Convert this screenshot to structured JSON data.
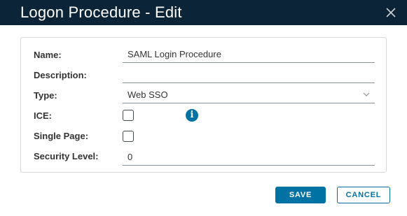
{
  "dialog": {
    "title": "Logon Procedure - Edit",
    "close_icon": "close-icon"
  },
  "form": {
    "name": {
      "label": "Name:",
      "value": "SAML Login Procedure"
    },
    "description": {
      "label": "Description:",
      "value": ""
    },
    "type": {
      "label": "Type:",
      "value": "Web SSO",
      "icon": "chevron-down-icon"
    },
    "ice": {
      "label": "ICE:",
      "checked": false,
      "info_icon": "info-icon",
      "info_glyph": "i"
    },
    "single_page": {
      "label": "Single Page:",
      "checked": false
    },
    "security_level": {
      "label": "Security Level:",
      "value": "0"
    }
  },
  "footer": {
    "save_label": "SAVE",
    "cancel_label": "CANCEL"
  },
  "colors": {
    "header_bg": "#0b2437",
    "accent": "#0072a3",
    "border": "#d4d8db"
  }
}
